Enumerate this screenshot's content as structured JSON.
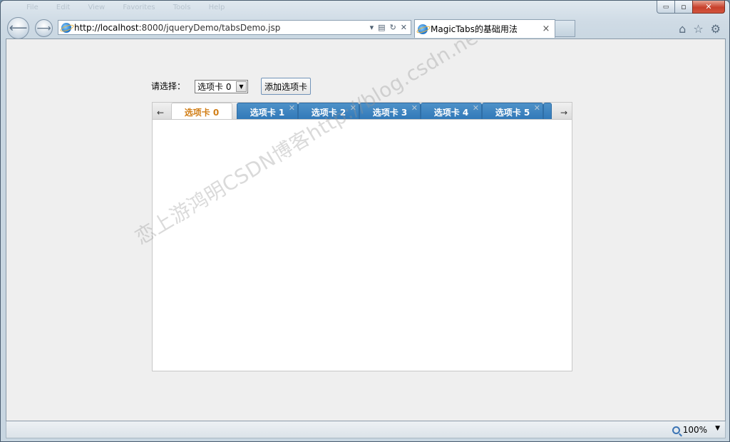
{
  "browser": {
    "ghost_menu": [
      "Favorites",
      "Tools",
      "Help",
      "View",
      "Edit",
      "File"
    ],
    "address": {
      "url_host": "http://localhost",
      "url_rest": ":8000/jqueryDemo/tabsDemo.jsp"
    },
    "tab": {
      "title": "MagicTabs的基础用法",
      "close_glyph": "×"
    },
    "window_controls": {
      "minimize": "▭",
      "maximize": "▫",
      "close": "✕"
    },
    "right_tools": {
      "home": "⌂",
      "favorites": "☆",
      "settings": "⚙"
    },
    "nav": {
      "back": "⟵",
      "forward": "⟶"
    },
    "status": {
      "zoom": "100%"
    }
  },
  "page": {
    "select_label": "请选择：",
    "select_value": "选项卡 0",
    "add_button": "添加选项卡",
    "tabs": [
      {
        "label": "选项卡 0",
        "closable": false
      },
      {
        "label": "选项卡 1",
        "closable": true
      },
      {
        "label": "选项卡 2",
        "closable": true
      },
      {
        "label": "选项卡 3",
        "closable": true
      },
      {
        "label": "选项卡 4",
        "closable": true
      },
      {
        "label": "选项卡 5",
        "closable": true
      }
    ],
    "active_tab_index": 0,
    "scroll_left": "←",
    "scroll_right": "→",
    "watermark": "恋上游鸿明CSDN博客http://blog.csdn.net/youqishini",
    "colors": {
      "tab_blue": "#3078b8",
      "active_tab_text": "#d17e16"
    }
  }
}
